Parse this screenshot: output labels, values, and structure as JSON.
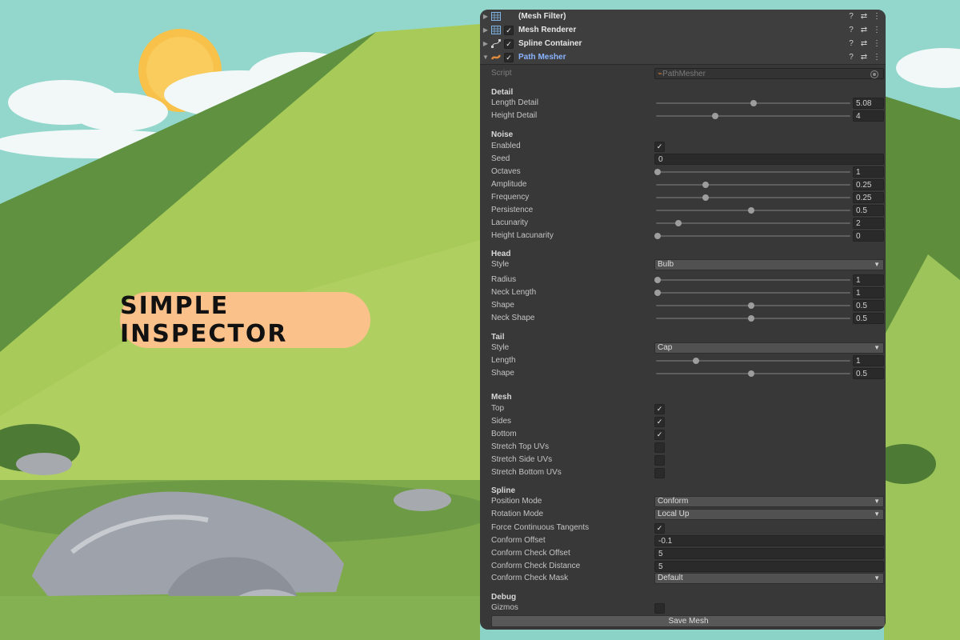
{
  "badge": {
    "text": "SIMPLE INSPECTOR"
  },
  "components": [
    {
      "name": "(Mesh Filter)",
      "icon": "mesh-filter-icon",
      "checkbox": false,
      "expanded": false
    },
    {
      "name": "Mesh Renderer",
      "icon": "mesh-renderer-icon",
      "checkbox": true,
      "expanded": false
    },
    {
      "name": "Spline Container",
      "icon": "spline-container-icon",
      "checkbox": true,
      "expanded": false
    },
    {
      "name": "Path Mesher",
      "icon": "path-mesher-icon",
      "checkbox": true,
      "expanded": true
    }
  ],
  "header_tools": {
    "help": "?",
    "presets": "⇄",
    "menu": "⋮"
  },
  "script": {
    "label": "Script",
    "value": "PathMesher"
  },
  "sections": {
    "detail": "Detail",
    "noise": "Noise",
    "head": "Head",
    "tail": "Tail",
    "mesh": "Mesh",
    "spline": "Spline",
    "debug": "Debug"
  },
  "detail": {
    "length_detail": {
      "label": "Length Detail",
      "value": "5.08",
      "frac": 0.5
    },
    "height_detail": {
      "label": "Height Detail",
      "value": "4",
      "frac": 0.3
    }
  },
  "noise": {
    "enabled": {
      "label": "Enabled",
      "checked": true
    },
    "seed": {
      "label": "Seed",
      "value": "0"
    },
    "octaves": {
      "label": "Octaves",
      "value": "1",
      "frac": 0.0
    },
    "amplitude": {
      "label": "Amplitude",
      "value": "0.25",
      "frac": 0.25
    },
    "frequency": {
      "label": "Frequency",
      "value": "0.25",
      "frac": 0.25
    },
    "persistence": {
      "label": "Persistence",
      "value": "0.5",
      "frac": 0.49
    },
    "lacunarity": {
      "label": "Lacunarity",
      "value": "2",
      "frac": 0.11
    },
    "height_lacunarity": {
      "label": "Height Lacunarity",
      "value": "0",
      "frac": 0.0
    }
  },
  "head": {
    "style": {
      "label": "Style",
      "value": "Bulb"
    },
    "radius": {
      "label": "Radius",
      "value": "1",
      "frac": 0.0
    },
    "neck_length": {
      "label": "Neck Length",
      "value": "1",
      "frac": 0.0
    },
    "shape": {
      "label": "Shape",
      "value": "0.5",
      "frac": 0.49
    },
    "neck_shape": {
      "label": "Neck Shape",
      "value": "0.5",
      "frac": 0.49
    }
  },
  "tail": {
    "style": {
      "label": "Style",
      "value": "Cap"
    },
    "length": {
      "label": "Length",
      "value": "1",
      "frac": 0.2
    },
    "shape": {
      "label": "Shape",
      "value": "0.5",
      "frac": 0.49
    }
  },
  "mesh": {
    "top": {
      "label": "Top",
      "checked": true
    },
    "sides": {
      "label": "Sides",
      "checked": true
    },
    "bottom": {
      "label": "Bottom",
      "checked": true
    },
    "stretch_top": {
      "label": "Stretch Top UVs",
      "checked": false
    },
    "stretch_side": {
      "label": "Stretch Side UVs",
      "checked": false
    },
    "stretch_bottom": {
      "label": "Stretch Bottom UVs",
      "checked": false
    }
  },
  "spline": {
    "position_mode": {
      "label": "Position Mode",
      "value": "Conform"
    },
    "rotation_mode": {
      "label": "Rotation Mode",
      "value": "Local Up"
    },
    "force_continuous": {
      "label": "Force Continuous Tangents",
      "checked": true
    },
    "conform_offset": {
      "label": "Conform Offset",
      "value": "-0.1"
    },
    "conform_check_offset": {
      "label": "Conform Check Offset",
      "value": "5"
    },
    "conform_check_distance": {
      "label": "Conform Check Distance",
      "value": "5"
    },
    "conform_check_mask": {
      "label": "Conform Check Mask",
      "value": "Default"
    }
  },
  "debug": {
    "gizmos": {
      "label": "Gizmos",
      "checked": false
    }
  },
  "save_button": "Save Mesh",
  "colors": {
    "sky": "#87d3c8",
    "mountain_light": "#a5c957",
    "mountain_dark": "#5e8d3c",
    "badge": "#fbc18a",
    "panel": "#383838",
    "accent_name": "#8ab4ff"
  }
}
